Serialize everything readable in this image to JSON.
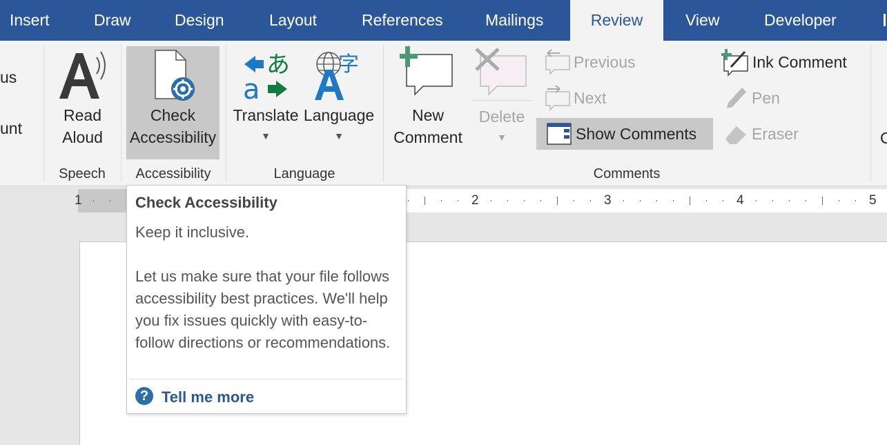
{
  "tabs": [
    {
      "label": "Insert"
    },
    {
      "label": "Draw"
    },
    {
      "label": "Design"
    },
    {
      "label": "Layout"
    },
    {
      "label": "References"
    },
    {
      "label": "Mailings"
    },
    {
      "label": "Review",
      "active": true
    },
    {
      "label": "View"
    },
    {
      "label": "Developer"
    }
  ],
  "ribbon": {
    "left_partial": {
      "line1": "us",
      "line2": "unt"
    },
    "speech": {
      "read_aloud": [
        "Read",
        "Aloud"
      ],
      "group_label": "Speech"
    },
    "accessibility": {
      "check": [
        "Check",
        "Accessibility"
      ],
      "group_label": "Accessibility"
    },
    "language": {
      "translate": "Translate",
      "language": "Language",
      "group_label": "Language"
    },
    "comments": {
      "new_comment": [
        "New",
        "Comment"
      ],
      "delete": "Delete",
      "previous": "Previous",
      "next": "Next",
      "show_comments": "Show Comments",
      "group_label": "Comments"
    },
    "ink": {
      "ink_comment": "Ink Comment",
      "pen": "Pen",
      "eraser": "Eraser"
    },
    "right_partial": "C"
  },
  "ruler": {
    "numbers": [
      "1",
      "2",
      "3",
      "4",
      "5"
    ]
  },
  "tooltip": {
    "title": "Check Accessibility",
    "tagline": "Keep it inclusive.",
    "body": "Let us make sure that your file follows accessibility best practices. We'll help you fix issues quickly with easy-to-follow directions or recommendations.",
    "link": "Tell me more"
  },
  "colors": {
    "accent": "#2b579a",
    "ribbon_bg": "#f3f3f3",
    "highlight": "#c8c8c8",
    "disabled": "#a6a6a6"
  }
}
